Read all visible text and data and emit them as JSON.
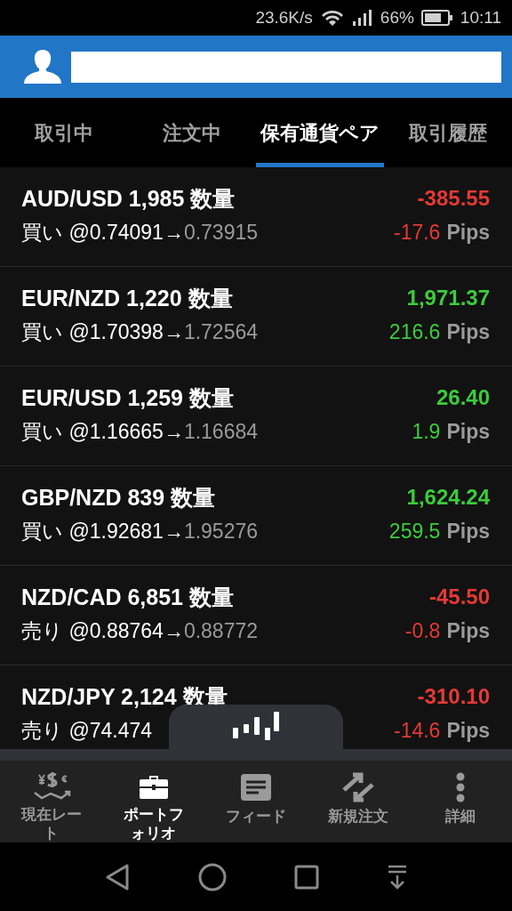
{
  "status_bar": {
    "speed": "23.6K/s",
    "battery": "66%",
    "time": "10:11"
  },
  "tabs": [
    {
      "label": "取引中",
      "selected": false
    },
    {
      "label": "注文中",
      "selected": false
    },
    {
      "label": "保有通貨ペア",
      "selected": true
    },
    {
      "label": "取引履歴",
      "selected": false
    }
  ],
  "positions": [
    {
      "title": "AUD/USD 1,985 数量",
      "entry": "買い @0.74091→",
      "current": "0.73915",
      "pnl": "-385.55",
      "pips": "-17.6",
      "pips_unit": "Pips",
      "color": "#e53935"
    },
    {
      "title": "EUR/NZD 1,220 数量",
      "entry": "買い @1.70398→",
      "current": "1.72564",
      "pnl": "1,971.37",
      "pips": "216.6",
      "pips_unit": "Pips",
      "color": "#3ccc3c"
    },
    {
      "title": "EUR/USD 1,259 数量",
      "entry": "買い @1.16665→",
      "current": "1.16684",
      "pnl": "26.40",
      "pips": "1.9",
      "pips_unit": "Pips",
      "color": "#3ccc3c"
    },
    {
      "title": "GBP/NZD 839 数量",
      "entry": "買い @1.92681→",
      "current": "1.95276",
      "pnl": "1,624.24",
      "pips": "259.5",
      "pips_unit": "Pips",
      "color": "#3ccc3c"
    },
    {
      "title": "NZD/CAD 6,851 数量",
      "entry": "売り @0.88764→",
      "current": "0.88772",
      "pnl": "-45.50",
      "pips": "-0.8",
      "pips_unit": "Pips",
      "color": "#e53935"
    },
    {
      "title": "NZD/JPY 2,124 数量",
      "entry": "売り @74.474",
      "pnl": "-310.10",
      "pips": "-14.6",
      "pips_unit": "Pips",
      "color": "#e53935"
    }
  ],
  "bottom_nav": [
    {
      "label": "現在レート",
      "kind": "rates",
      "selected": false
    },
    {
      "label": "ポートフォリオ",
      "kind": "portfolio",
      "selected": true
    },
    {
      "label": "フィード",
      "kind": "feed",
      "selected": false
    },
    {
      "label": "新規注文",
      "kind": "order",
      "selected": false
    },
    {
      "label": "詳細",
      "kind": "more",
      "selected": false
    }
  ]
}
